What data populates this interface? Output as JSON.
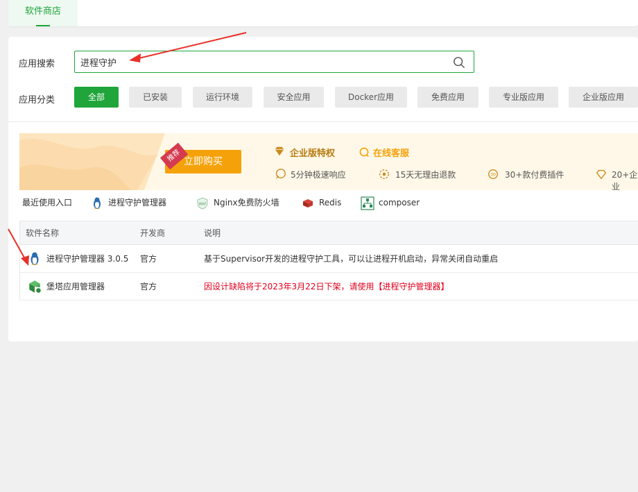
{
  "tabs": {
    "store": "软件商店"
  },
  "search": {
    "label": "应用搜索",
    "value": "进程守护",
    "icon": "search-icon"
  },
  "categories": {
    "label": "应用分类",
    "items": [
      "全部",
      "已安装",
      "运行环境",
      "安全应用",
      "Docker应用",
      "免费应用",
      "专业版应用",
      "企业版应用"
    ]
  },
  "banner": {
    "ribbon": "推荐",
    "buy_label": "立即购买",
    "enterprise_title": "企业版特权",
    "online_service": "在线客服",
    "features": [
      "5分钟极速响应",
      "15天无理由退款",
      "30+款付费插件",
      "20+企业"
    ]
  },
  "recent": {
    "label": "最近使用入口",
    "items": [
      "进程守护管理器",
      "Nginx免费防火墙",
      "Redis",
      "composer"
    ]
  },
  "table": {
    "headers": [
      "软件名称",
      "开发商",
      "说明"
    ],
    "rows": [
      {
        "name": "进程守护管理器 3.0.5",
        "vendor": "官方",
        "desc": "基于Supervisor开发的进程守护工具，可以让进程开机启动，异常关闭自动重启"
      },
      {
        "name": "堡塔应用管理器",
        "vendor": "官方",
        "desc": "因设计缺陷将于2023年3月22日下架，请使用【进程守护管理器】"
      }
    ]
  },
  "colors": {
    "accent": "#20a53a",
    "warning": "#e1001e",
    "gold": "#f5a20a",
    "annotation_arrow": "#e8302a"
  }
}
